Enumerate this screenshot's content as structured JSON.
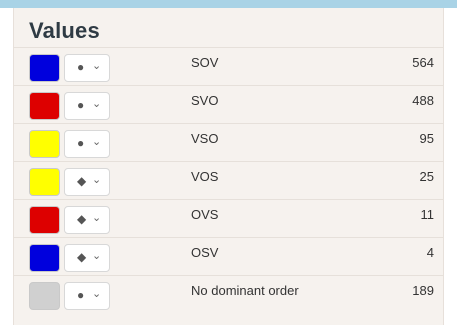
{
  "panel": {
    "title": "Values"
  },
  "rows": [
    {
      "swatch_color": "#0000dd",
      "shape": "circle",
      "shape_glyph": "●",
      "chevron_icon": "chevron-down-icon",
      "label": "SOV",
      "count": "564"
    },
    {
      "swatch_color": "#dd0000",
      "shape": "circle",
      "shape_glyph": "●",
      "chevron_icon": "chevron-down-icon",
      "label": "SVO",
      "count": "488"
    },
    {
      "swatch_color": "#ffff00",
      "shape": "circle",
      "shape_glyph": "●",
      "chevron_icon": "chevron-down-icon",
      "label": "VSO",
      "count": "95"
    },
    {
      "swatch_color": "#ffff00",
      "shape": "diamond",
      "shape_glyph": "◆",
      "chevron_icon": "chevron-down-icon",
      "label": "VOS",
      "count": "25"
    },
    {
      "swatch_color": "#dd0000",
      "shape": "diamond",
      "shape_glyph": "◆",
      "chevron_icon": "chevron-down-icon",
      "label": "OVS",
      "count": "11"
    },
    {
      "swatch_color": "#0000dd",
      "shape": "diamond",
      "shape_glyph": "◆",
      "chevron_icon": "chevron-down-icon",
      "label": "OSV",
      "count": "4"
    },
    {
      "swatch_color": "#d0d0d0",
      "shape": "circle",
      "shape_glyph": "●",
      "chevron_icon": "chevron-down-icon",
      "label": "No dominant order",
      "count": "189"
    }
  ]
}
